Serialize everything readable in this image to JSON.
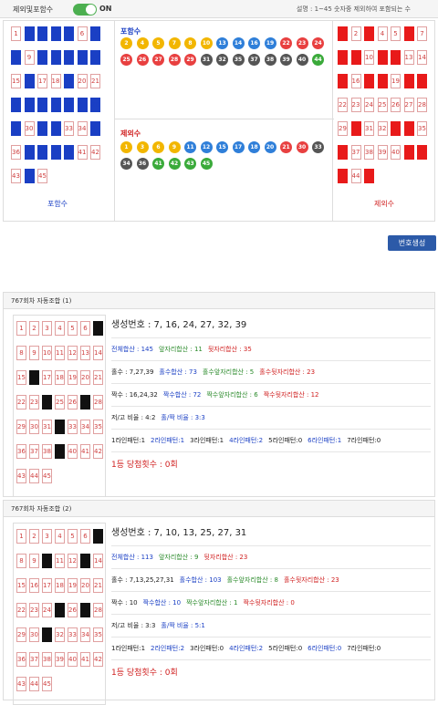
{
  "topbar": {
    "exclude_label": "제외및포함수",
    "toggle_label": "ON",
    "description": "설명 : 1~45 숫자중 제외하여 포함되는 수"
  },
  "include_label": "포함수",
  "exclude_label": "제외수",
  "left_grid_blue": [
    2,
    3,
    4,
    5,
    7,
    8,
    10,
    11,
    12,
    13,
    14,
    16,
    19,
    22,
    23,
    24,
    25,
    26,
    27,
    28,
    29,
    31,
    32,
    35,
    37,
    38,
    39,
    40,
    44
  ],
  "right_grid_red": [
    1,
    3,
    6,
    8,
    9,
    11,
    12,
    15,
    17,
    18,
    20,
    21,
    30,
    33,
    34,
    36,
    41,
    42,
    43,
    45
  ],
  "include_balls": [
    {
      "n": "2",
      "c": "#f2b600"
    },
    {
      "n": "4",
      "c": "#f2b600"
    },
    {
      "n": "5",
      "c": "#f2b600"
    },
    {
      "n": "7",
      "c": "#f2b600"
    },
    {
      "n": "8",
      "c": "#f2b600"
    },
    {
      "n": "10",
      "c": "#f2b600"
    },
    {
      "n": "13",
      "c": "#2f7fd9"
    },
    {
      "n": "14",
      "c": "#2f7fd9"
    },
    {
      "n": "16",
      "c": "#2f7fd9"
    },
    {
      "n": "19",
      "c": "#2f7fd9"
    },
    {
      "n": "22",
      "c": "#e84040"
    },
    {
      "n": "23",
      "c": "#e84040"
    },
    {
      "n": "24",
      "c": "#e84040"
    },
    {
      "n": "25",
      "c": "#e84040"
    },
    {
      "n": "26",
      "c": "#e84040"
    },
    {
      "n": "27",
      "c": "#e84040"
    },
    {
      "n": "28",
      "c": "#e84040"
    },
    {
      "n": "29",
      "c": "#e84040"
    },
    {
      "n": "31",
      "c": "#555555"
    },
    {
      "n": "32",
      "c": "#555555"
    },
    {
      "n": "35",
      "c": "#555555"
    },
    {
      "n": "37",
      "c": "#555555"
    },
    {
      "n": "38",
      "c": "#555555"
    },
    {
      "n": "39",
      "c": "#555555"
    },
    {
      "n": "40",
      "c": "#555555"
    },
    {
      "n": "44",
      "c": "#3aaa3a"
    }
  ],
  "exclude_balls": [
    {
      "n": "1",
      "c": "#f2b600"
    },
    {
      "n": "3",
      "c": "#f2b600"
    },
    {
      "n": "6",
      "c": "#f2b600"
    },
    {
      "n": "9",
      "c": "#f2b600"
    },
    {
      "n": "11",
      "c": "#2f7fd9"
    },
    {
      "n": "12",
      "c": "#2f7fd9"
    },
    {
      "n": "15",
      "c": "#2f7fd9"
    },
    {
      "n": "17",
      "c": "#2f7fd9"
    },
    {
      "n": "18",
      "c": "#2f7fd9"
    },
    {
      "n": "20",
      "c": "#2f7fd9"
    },
    {
      "n": "21",
      "c": "#e84040"
    },
    {
      "n": "30",
      "c": "#e84040"
    },
    {
      "n": "33",
      "c": "#555555"
    },
    {
      "n": "34",
      "c": "#555555"
    },
    {
      "n": "36",
      "c": "#555555"
    },
    {
      "n": "41",
      "c": "#3aaa3a"
    },
    {
      "n": "42",
      "c": "#3aaa3a"
    },
    {
      "n": "43",
      "c": "#3aaa3a"
    },
    {
      "n": "45",
      "c": "#3aaa3a"
    }
  ],
  "generate_button": "번호생성",
  "combos": [
    {
      "title": "767회차 자동조합 (1)",
      "picked": [
        7,
        16,
        24,
        27,
        32,
        39
      ],
      "gen": "생성번호 : 7, 16, 24, 27, 32, 39",
      "sum": "전체합산 : 145",
      "front": "앞자리합산 : 11",
      "back": "뒷자리합산 : 35",
      "odd": "홀수 : 7,27,39",
      "oddsum": "홀수합산 : 73",
      "oddfront": "홀수앞자리합산 : 5",
      "oddback": "홀수뒷자리합산 : 23",
      "even": "짝수 : 16,24,32",
      "evensum": "짝수합산 : 72",
      "evenfront": "짝수앞자리합산 : 6",
      "evenback": "짝수뒷자리합산 : 12",
      "lowhigh": "저/고 비율 : 4:2",
      "oddeven": "홀/짝 비율 : 3:3",
      "lines": [
        "1라인패턴:1",
        "2라인패턴:1",
        "3라인패턴:1",
        "4라인패턴:2",
        "5라인패턴:0",
        "6라인패턴:1",
        "7라인패턴:0"
      ],
      "prize": "1등 당첨횟수 : 0회"
    },
    {
      "title": "767회차 자동조합 (2)",
      "picked": [
        7,
        10,
        13,
        25,
        27,
        31
      ],
      "gen": "생성번호 : 7, 10, 13, 25, 27, 31",
      "sum": "전체합산 : 113",
      "front": "앞자리합산 : 9",
      "back": "뒷자리합산 : 23",
      "odd": "홀수 : 7,13,25,27,31",
      "oddsum": "홀수합산 : 103",
      "oddfront": "홀수앞자리합산 : 8",
      "oddback": "홀수뒷자리합산 : 23",
      "even": "짝수 : 10",
      "evensum": "짝수합산 : 10",
      "evenfront": "짝수앞자리합산 : 1",
      "evenback": "짝수뒷자리합산 : 0",
      "lowhigh": "저/고 비율 : 3:3",
      "oddeven": "홀/짝 비율 : 5:1",
      "lines": [
        "1라인패턴:1",
        "2라인패턴:2",
        "3라인패턴:0",
        "4라인패턴:2",
        "5라인패턴:0",
        "6라인패턴:0",
        "7라인패턴:0"
      ],
      "prize": "1등 당첨횟수 : 0회"
    }
  ]
}
